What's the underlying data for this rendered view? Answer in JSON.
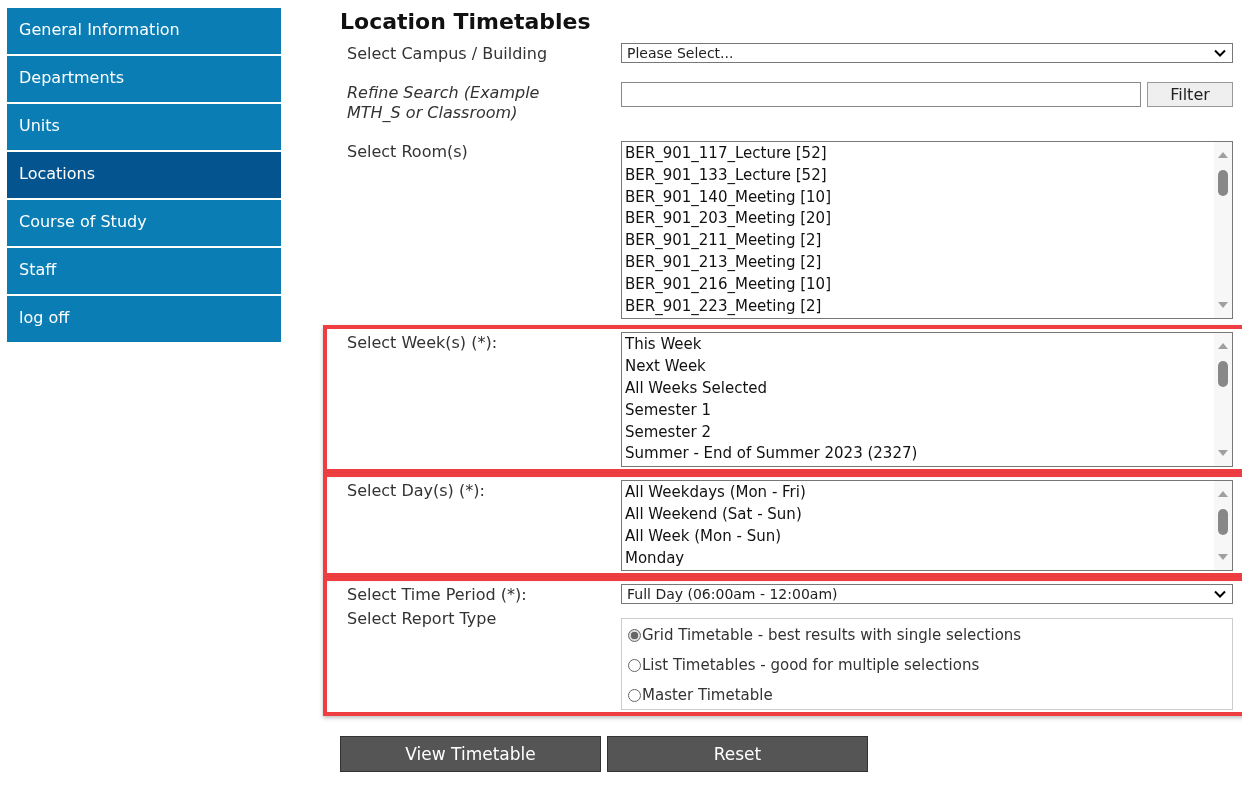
{
  "sidebar": {
    "items": [
      {
        "label": "General Information",
        "selected": false
      },
      {
        "label": "Departments",
        "selected": false
      },
      {
        "label": "Units",
        "selected": false
      },
      {
        "label": "Locations",
        "selected": true
      },
      {
        "label": "Course of Study",
        "selected": false
      },
      {
        "label": "Staff",
        "selected": false
      },
      {
        "label": "log off",
        "selected": false
      }
    ]
  },
  "title": "Location Timetables",
  "sections": [
    {
      "highlighted": false,
      "rows": [
        {
          "kind": "select",
          "label": "Select Campus / Building",
          "value": "Please Select..."
        },
        {
          "kind": "search",
          "label": "Refine Search (Example MTH_S or Classroom)",
          "button": "Filter"
        },
        {
          "kind": "listbox",
          "label": "Select Room(s)",
          "options": [
            "BER_901_117_Lecture [52]",
            "BER_901_133_Lecture [52]",
            "BER_901_140_Meeting [10]",
            "BER_901_203_Meeting [20]",
            "BER_901_211_Meeting [2]",
            "BER_901_213_Meeting [2]",
            "BER_901_216_Meeting [10]",
            "BER_901_223_Meeting [2]"
          ]
        }
      ]
    },
    {
      "highlighted": true,
      "rows": [
        {
          "kind": "listbox",
          "label": "Select Week(s) (*):",
          "options": [
            "This Week",
            "Next Week",
            "All Weeks Selected",
            "Semester 1",
            "Semester 2",
            "Summer - End of Summer 2023 (2327)"
          ]
        }
      ]
    },
    {
      "highlighted": true,
      "rows": [
        {
          "kind": "listbox",
          "label": "Select Day(s) (*):",
          "options": [
            "All Weekdays (Mon - Fri)",
            "All Weekend (Sat - Sun)",
            "All Week (Mon - Sun)",
            "Monday"
          ]
        }
      ]
    },
    {
      "highlighted": true,
      "rows": [
        {
          "kind": "select",
          "label": "Select Time Period (*):",
          "value": "Full Day (06:00am - 12:00am)"
        },
        {
          "kind": "radios",
          "label": "Select Report Type",
          "options": [
            {
              "label": "Grid Timetable - best results with single selections",
              "selected": true
            },
            {
              "label": "List Timetables - good for multiple selections",
              "selected": false
            },
            {
              "label": "Master Timetable",
              "selected": false
            }
          ]
        }
      ]
    }
  ],
  "buttons": [
    "View Timetable",
    "Reset"
  ]
}
